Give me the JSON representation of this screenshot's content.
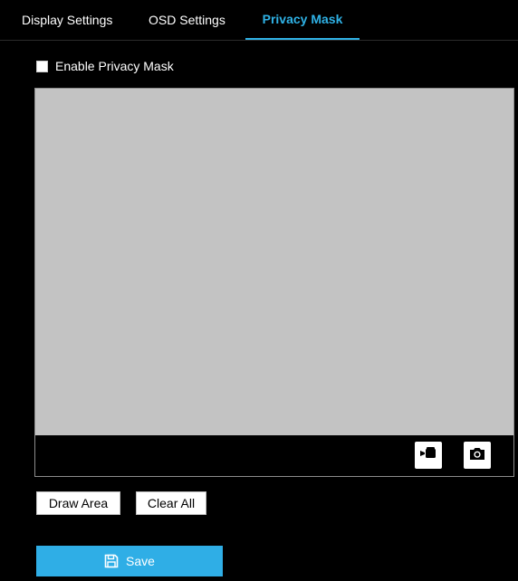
{
  "tabs": [
    {
      "label": "Display Settings",
      "active": false
    },
    {
      "label": "OSD Settings",
      "active": false
    },
    {
      "label": "Privacy Mask",
      "active": true
    }
  ],
  "enable_privacy_mask": {
    "label": "Enable Privacy Mask",
    "checked": false
  },
  "video": {
    "controls": [
      {
        "icon": "record-video-icon"
      },
      {
        "icon": "camera-snapshot-icon"
      }
    ]
  },
  "actions": {
    "draw_area_label": "Draw Area",
    "clear_all_label": "Clear All",
    "save_label": "Save",
    "save_icon": "save-disk-icon"
  },
  "colors": {
    "background": "#000000",
    "accent": "#2faee6",
    "video_placeholder": "#c3c3c3",
    "text": "#ffffff"
  }
}
